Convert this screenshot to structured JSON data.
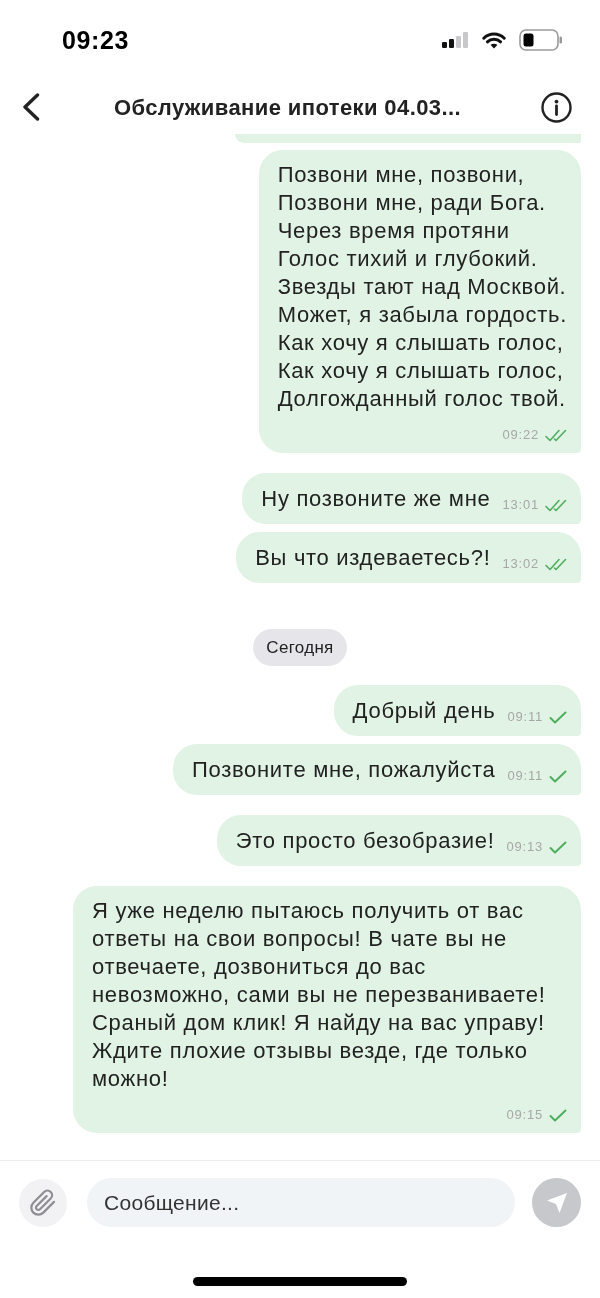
{
  "status_bar": {
    "time": "09:23"
  },
  "header": {
    "title": "Обслуживание ипотеки 04.03..."
  },
  "messages": [
    {
      "kind": "partial"
    },
    {
      "kind": "message",
      "text": "Позвони мне, позвони,\nПозвони мне, ради Бога.\nЧерез время протяни\nГолос тихий и глубокий.\nЗвезды тают над Москвой.\nМожет, я забыла гордость.\nКак хочу я слышать голос,\nКак хочу я слышать голос,\nДолгожданный голос твой.",
      "time": "09:22",
      "read": true
    },
    {
      "kind": "message",
      "text": "Ну позвоните же мне",
      "time": "13:01",
      "read": true
    },
    {
      "kind": "message",
      "text": "Вы что издеваетесь?!",
      "time": "13:02",
      "read": true
    },
    {
      "kind": "date",
      "text": "Сегодня"
    },
    {
      "kind": "message",
      "text": "Добрый день",
      "time": "09:11",
      "read": false
    },
    {
      "kind": "message",
      "text": "Позвоните мне, пожалуйста",
      "time": "09:11",
      "read": false
    },
    {
      "kind": "message",
      "text": "Это просто безобразие!",
      "time": "09:13",
      "read": false
    },
    {
      "kind": "message",
      "text": "Я уже неделю пытаюсь получить от вас ответы на свои вопросы! В чате вы не отвечаете, дозвониться до вас невозможно, сами вы не перезваниваете! Сраный дом клик! Я найду на вас управу! Ждите плохие отзывы везде, где только можно!",
      "time": "09:15",
      "read": false
    }
  ],
  "composer": {
    "placeholder": "Сообщение..."
  }
}
